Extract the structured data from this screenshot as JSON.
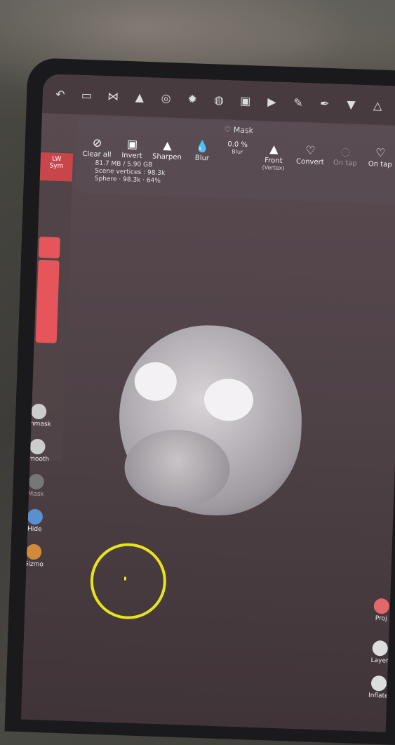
{
  "toolbar": {
    "icons": [
      "back-icon",
      "folder-icon",
      "share-icon",
      "layers-icon",
      "globe-icon",
      "sun-icon",
      "sphere-icon",
      "image-icon",
      "video-icon",
      "brush-icon",
      "pen-icon",
      "bucket-icon",
      "triangle-icon",
      "flask-icon"
    ]
  },
  "mask": {
    "header": "Mask",
    "tools": [
      {
        "label": "Clear all",
        "sub": ""
      },
      {
        "label": "Invert",
        "sub": ""
      },
      {
        "label": "Sharpen",
        "sub": ""
      },
      {
        "label": "Blur",
        "sub": ""
      },
      {
        "label": "0.0 %",
        "sub": "Blur"
      },
      {
        "label": "Front",
        "sub": "(Vertex)"
      },
      {
        "label": "Convert",
        "sub": ""
      },
      {
        "label": "On tap",
        "sub": ""
      },
      {
        "label": "On tap",
        "sub": ""
      }
    ]
  },
  "stats": {
    "memory": "81.7 MB / 5.90 GB",
    "scene_vertices": "Scene vertices : 98.3k",
    "sphere": "Sphere · 98.3k · 64%"
  },
  "left": {
    "sym": "Sym",
    "lw": "LW",
    "tools": [
      "Unmask",
      "Smooth",
      "Mask",
      "Hide",
      "Gizmo"
    ]
  },
  "right": {
    "tools": [
      "Proj",
      "Layer",
      "Inflate"
    ]
  }
}
